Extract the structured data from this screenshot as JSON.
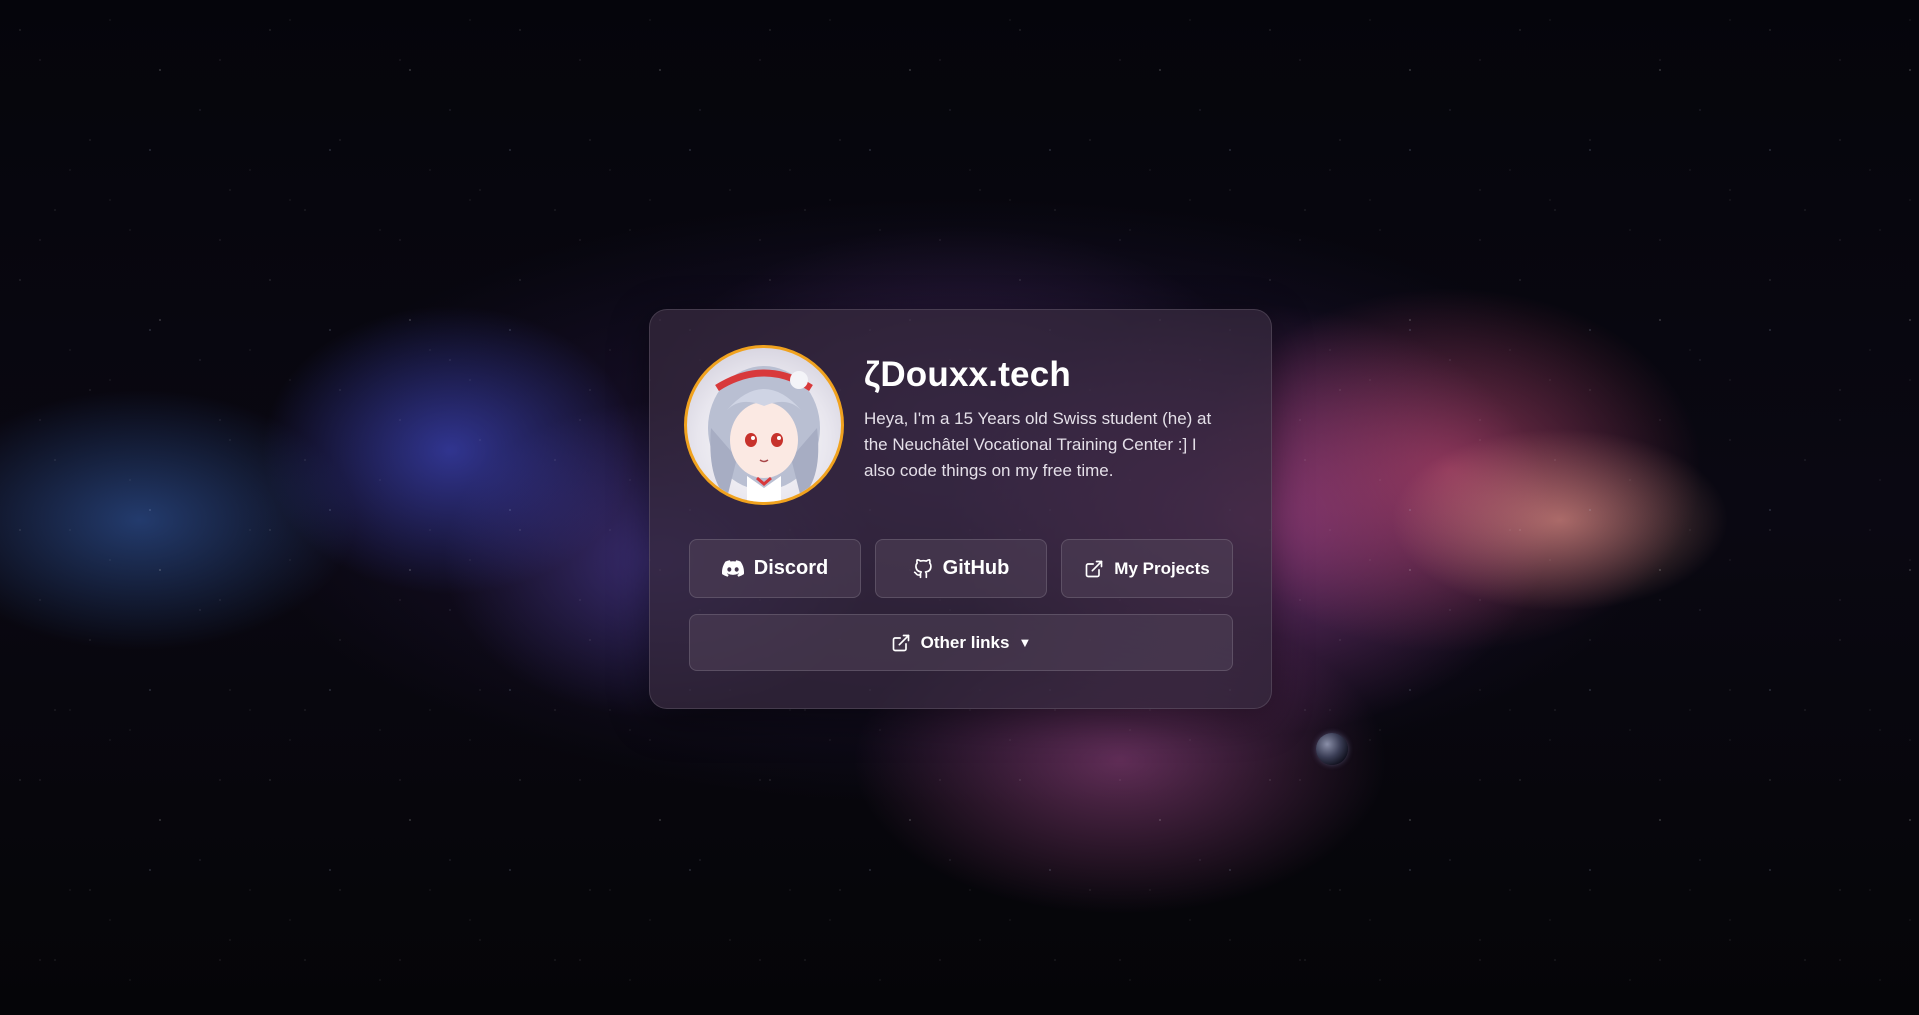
{
  "profile": {
    "name": "ζDouxx.tech",
    "bio": "Heya, I'm a 15 Years old Swiss student (he) at the Neuchâtel Vocational Training Center :] I also code things on my free time."
  },
  "buttons": {
    "discord": {
      "label": "Discord",
      "icon": "discord-icon"
    },
    "github": {
      "label": "GitHub",
      "icon": "github-icon"
    },
    "projects": {
      "label": "My Projects",
      "icon": "external-link-icon"
    },
    "other_links": {
      "label": "Other links",
      "icon": "external-link-icon",
      "caret": "▼"
    }
  },
  "colors": {
    "avatar_ring": "#f0a21e",
    "text": "#ffffff"
  }
}
